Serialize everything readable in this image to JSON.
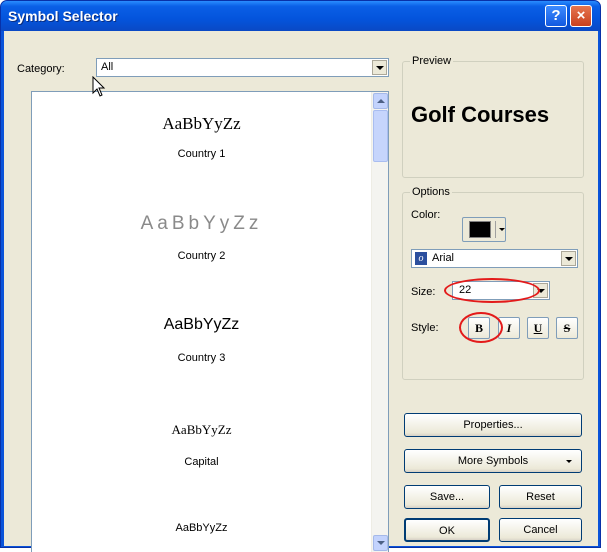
{
  "window": {
    "title": "Symbol Selector",
    "help_glyph": "?",
    "close_glyph": "×"
  },
  "category": {
    "label": "Category:",
    "selected": "All"
  },
  "symbols": [
    {
      "sample": "AaBbYyZz",
      "name": "Country 1"
    },
    {
      "sample": "AaBbYyZz",
      "name": "Country 2"
    },
    {
      "sample": "AaBbYyZz",
      "name": "Country 3"
    },
    {
      "sample": "AaBbYyZz",
      "name": "Capital"
    },
    {
      "sample": "AaBbYyZz",
      "name": ""
    }
  ],
  "preview": {
    "label": "Preview",
    "text": "Golf Courses"
  },
  "options": {
    "label": "Options",
    "color_label": "Color:",
    "color_value": "#000000",
    "font": "Arial",
    "size_label": "Size:",
    "size_value": "22",
    "style_label": "Style:",
    "bold": "B",
    "italic": "I",
    "underline": "U",
    "strikethrough": "S"
  },
  "buttons": {
    "properties": "Properties...",
    "more_symbols": "More Symbols",
    "save": "Save...",
    "reset": "Reset",
    "ok": "OK",
    "cancel": "Cancel"
  },
  "colors": {
    "titlebar": "#0454dc",
    "client": "#ece9d8",
    "highlight": "#e31a1a"
  }
}
